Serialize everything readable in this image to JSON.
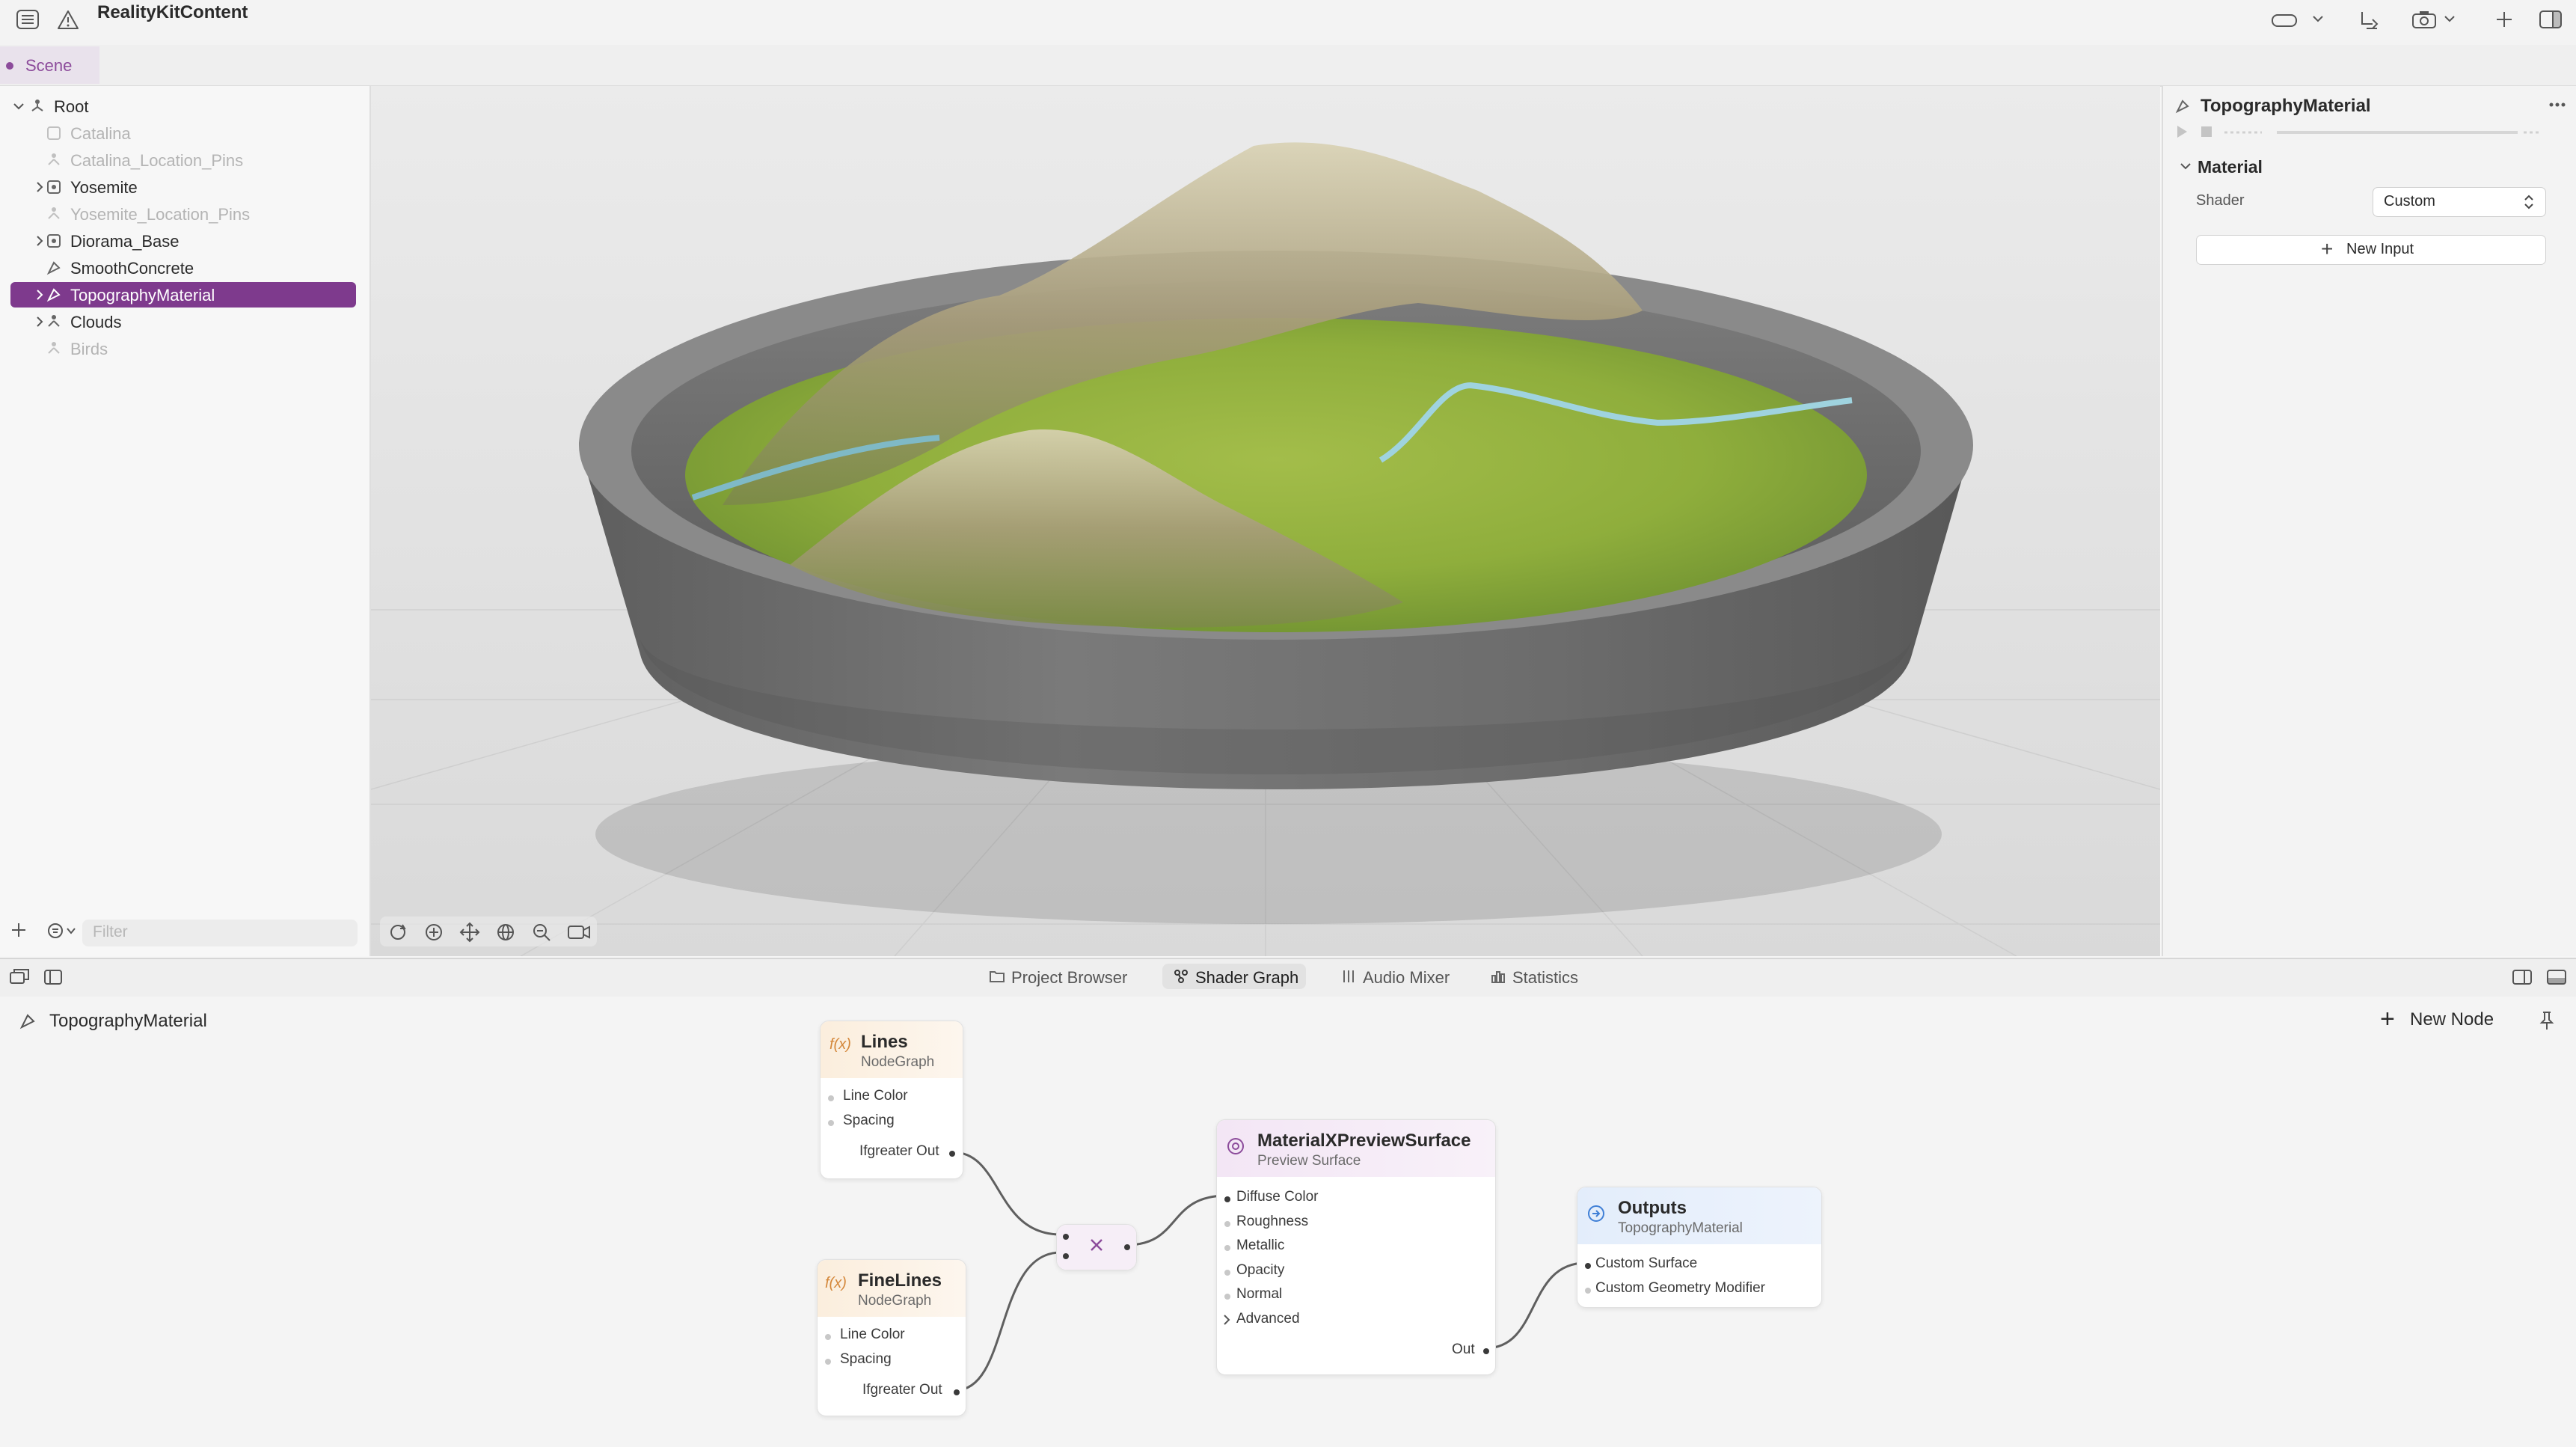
{
  "app": {
    "title": "RealityKitContent"
  },
  "tabs": {
    "scene_label": "Scene"
  },
  "outline": {
    "items": [
      {
        "label": "Root"
      },
      {
        "label": "Catalina"
      },
      {
        "label": "Catalina_Location_Pins"
      },
      {
        "label": "Yosemite"
      },
      {
        "label": "Yosemite_Location_Pins"
      },
      {
        "label": "Diorama_Base"
      },
      {
        "label": "SmoothConcrete"
      },
      {
        "label": "TopographyMaterial"
      },
      {
        "label": "Clouds"
      },
      {
        "label": "Birds"
      }
    ],
    "filter_placeholder": "Filter"
  },
  "inspector": {
    "title": "TopographyMaterial",
    "section": "Material",
    "shader_label": "Shader",
    "shader_value": "Custom",
    "new_input_label": "New Input"
  },
  "bottom_tabs": [
    "Project Browser",
    "Shader Graph",
    "Audio Mixer",
    "Statistics"
  ],
  "graph": {
    "title": "TopographyMaterial",
    "new_node_label": "New Node",
    "nodes": {
      "lines": {
        "title": "Lines",
        "subtitle": "NodeGraph",
        "inputs": [
          "Line Color",
          "Spacing"
        ],
        "output": "Ifgreater Out"
      },
      "finelines": {
        "title": "FineLines",
        "subtitle": "NodeGraph",
        "inputs": [
          "Line Color",
          "Spacing"
        ],
        "output": "Ifgreater Out"
      },
      "preview": {
        "title": "MaterialXPreviewSurface",
        "subtitle": "Preview Surface",
        "inputs": [
          "Diffuse Color",
          "Roughness",
          "Metallic",
          "Opacity",
          "Normal",
          "Advanced"
        ],
        "output": "Out"
      },
      "outputs": {
        "title": "Outputs",
        "subtitle": "TopographyMaterial",
        "inputs": [
          "Custom Surface",
          "Custom Geometry Modifier"
        ]
      }
    }
  },
  "colors": {
    "accent": "#7e3a8d",
    "scene_tab": "#8c4b9b"
  }
}
